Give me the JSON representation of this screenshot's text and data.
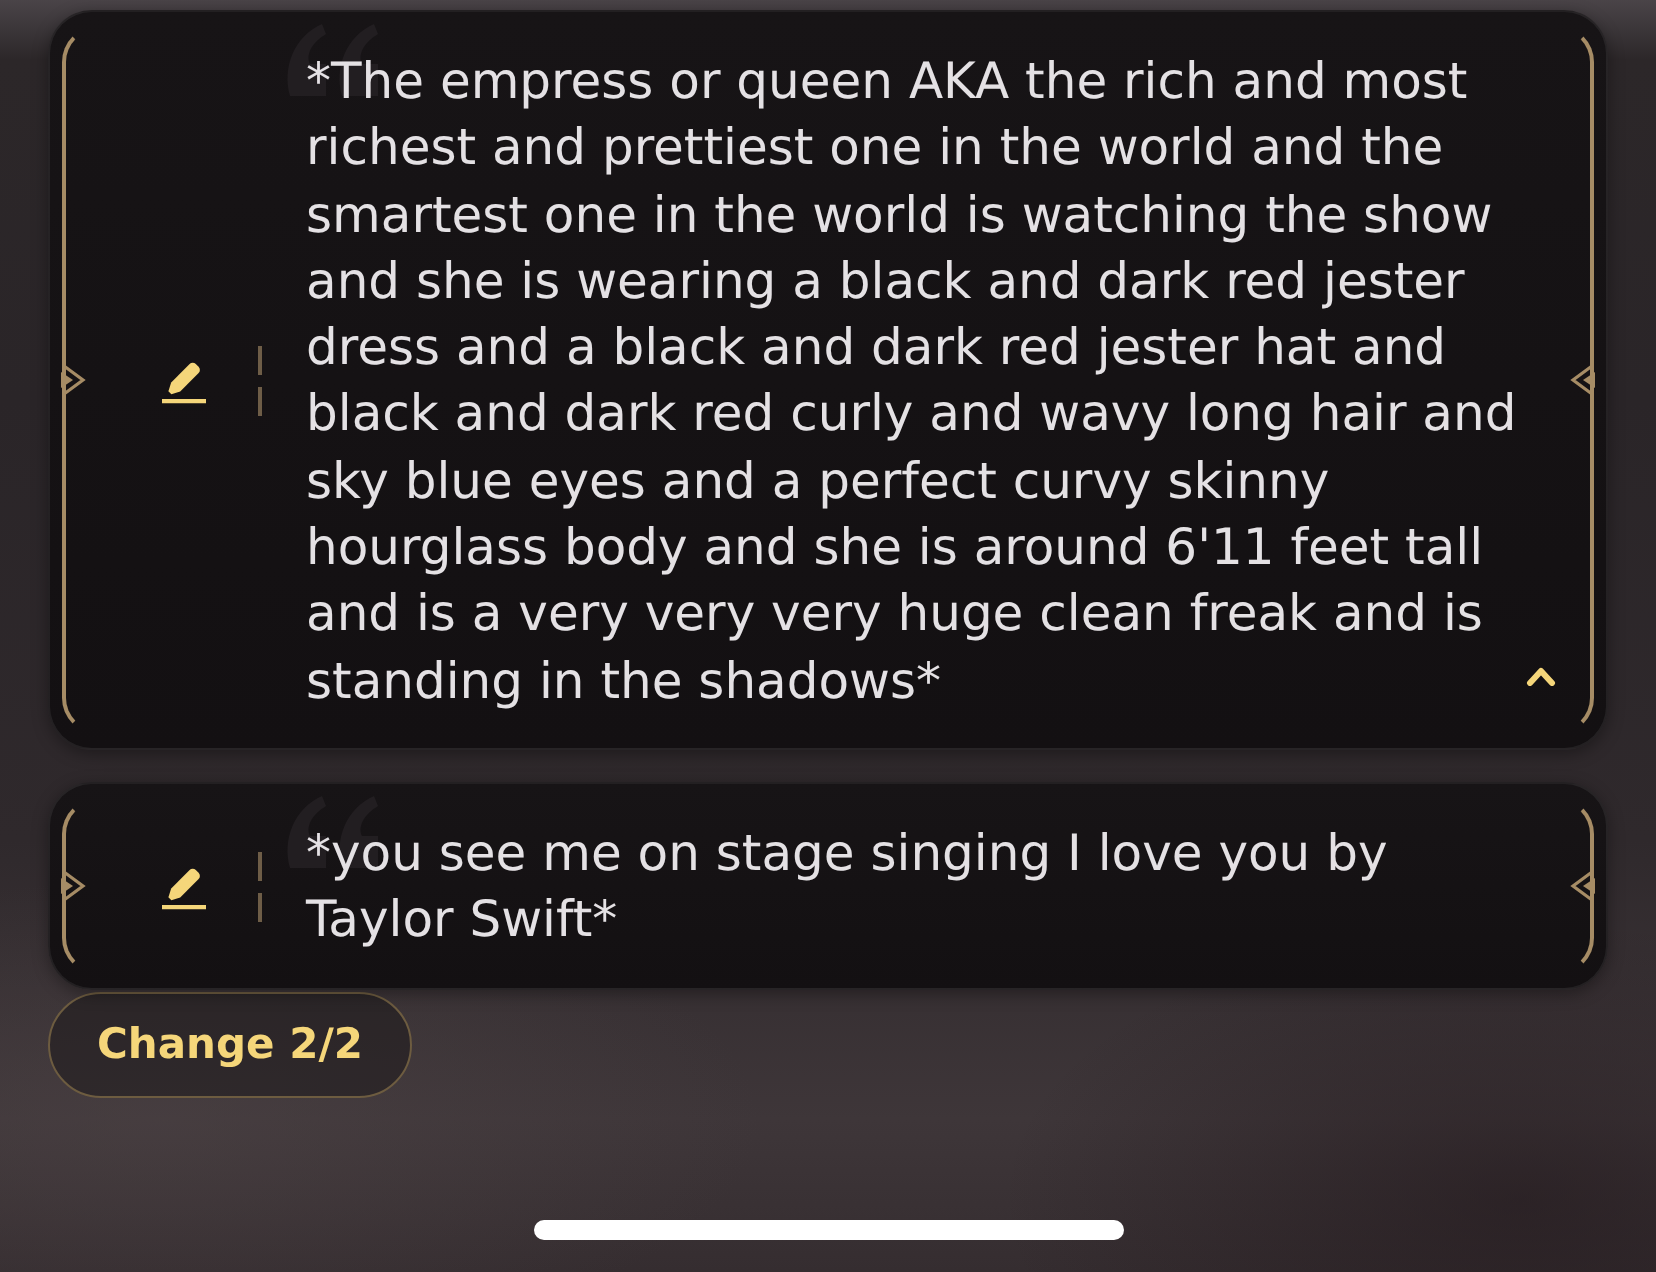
{
  "messages": [
    {
      "text": "*The empress or queen AKA the rich and most richest and prettiest one in the world and the smartest one in the world is watching the show and she is wearing a black and dark red jester dress and a black and dark red jester hat and black and dark red curly and wavy long hair and sky blue eyes and a perfect curvy skinny hourglass body and she is around 6'11 feet tall and is a very very very huge clean freak and is standing in the shadows*",
      "expanded": true
    },
    {
      "text": "*you see me on stage singing I love you by Taylor Swift*",
      "expanded": false
    }
  ],
  "change_button": {
    "label": "Change 2/2"
  }
}
